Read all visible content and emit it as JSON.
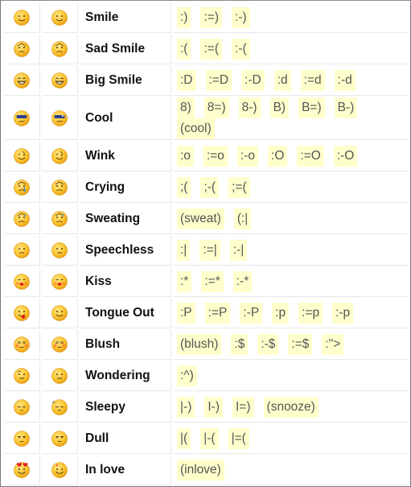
{
  "colors": {
    "code_bg": "#ffffcc",
    "code_text": "#555555",
    "name_text": "#111111",
    "face_yellow": "#f7c02c",
    "face_dark": "#5a3a10"
  },
  "emoticons": [
    {
      "name": "Smile",
      "icon": "smile-icon",
      "codes": [
        ":)",
        ":=)",
        ":-)"
      ]
    },
    {
      "name": "Sad Smile",
      "icon": "sad-smile-icon",
      "codes": [
        ":(",
        ":=(",
        ":-("
      ]
    },
    {
      "name": "Big Smile",
      "icon": "big-smile-icon",
      "codes": [
        ":D",
        ":=D",
        ":-D",
        ":d",
        ":=d",
        ":-d"
      ]
    },
    {
      "name": "Cool",
      "icon": "cool-icon",
      "codes": [
        "8)",
        "8=)",
        "8-)",
        "B)",
        "B=)",
        "B-)",
        "(cool)"
      ]
    },
    {
      "name": "Wink",
      "icon": "wink-icon",
      "codes": [
        ":o",
        ":=o",
        ":-o",
        ":O",
        ":=O",
        ":-O"
      ]
    },
    {
      "name": "Crying",
      "icon": "crying-icon",
      "codes": [
        ";(",
        ";-(",
        ";=("
      ]
    },
    {
      "name": "Sweating",
      "icon": "sweating-icon",
      "codes": [
        "(sweat)",
        "(:|"
      ]
    },
    {
      "name": "Speechless",
      "icon": "speechless-icon",
      "codes": [
        ":|",
        ":=|",
        ":-|"
      ]
    },
    {
      "name": "Kiss",
      "icon": "kiss-icon",
      "codes": [
        ":*",
        ":=*",
        ":-*"
      ]
    },
    {
      "name": "Tongue Out",
      "icon": "tongue-out-icon",
      "codes": [
        ":P",
        ":=P",
        ":-P",
        ":p",
        ":=p",
        ":-p"
      ]
    },
    {
      "name": "Blush",
      "icon": "blush-icon",
      "codes": [
        "(blush)",
        ":$",
        ":-$",
        ":=$",
        ":\">"
      ]
    },
    {
      "name": "Wondering",
      "icon": "wondering-icon",
      "codes": [
        ":^)"
      ]
    },
    {
      "name": "Sleepy",
      "icon": "sleepy-icon",
      "codes": [
        "|-)",
        "I-)",
        "I=)",
        "(snooze)"
      ]
    },
    {
      "name": "Dull",
      "icon": "dull-icon",
      "codes": [
        "|(",
        "|-(",
        "|=("
      ]
    },
    {
      "name": "In love",
      "icon": "in-love-icon",
      "codes": [
        "(inlove)"
      ]
    }
  ]
}
